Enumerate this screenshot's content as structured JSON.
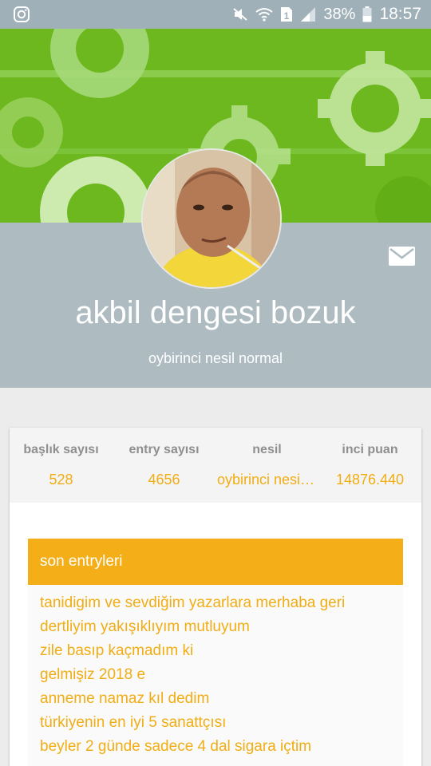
{
  "status_bar": {
    "battery_percent": "38%",
    "time": "18:57",
    "sim_slot": "1",
    "icons": [
      "instagram-icon",
      "mute-icon",
      "wifi-icon",
      "sim-icon",
      "signal-icon",
      "battery-icon"
    ]
  },
  "profile": {
    "username": "akbil dengesi bozuk",
    "generation": "oybirinci nesil normal",
    "avatar": "user-avatar-photo",
    "message_icon": "mail-icon"
  },
  "stats": [
    {
      "label": "başlık sayısı",
      "value": "528"
    },
    {
      "label": "entry sayısı",
      "value": "4656"
    },
    {
      "label": "nesil",
      "value": "oybirinci nesil normal"
    },
    {
      "label": "inci puan",
      "value": "14876.440"
    }
  ],
  "recent_entries": {
    "title": "son entryleri",
    "items": [
      "tanidigim ve sevdiğim yazarlara merhaba geri",
      "dertliyim yakışıklıyım mutluyum",
      "zile basıp kaçmadım ki",
      "gelmişiz 2018 e",
      "anneme namaz kıl dedim",
      "türkiyenin en iyi 5 sanattçısı",
      "beyler 2 günde sadece 4 dal sigara içtim"
    ]
  },
  "colors": {
    "accent": "#f3ae18",
    "status_bar": "#9fb0b8",
    "profile_band": "#aebcc2",
    "banner_green": "#6cb81e"
  }
}
